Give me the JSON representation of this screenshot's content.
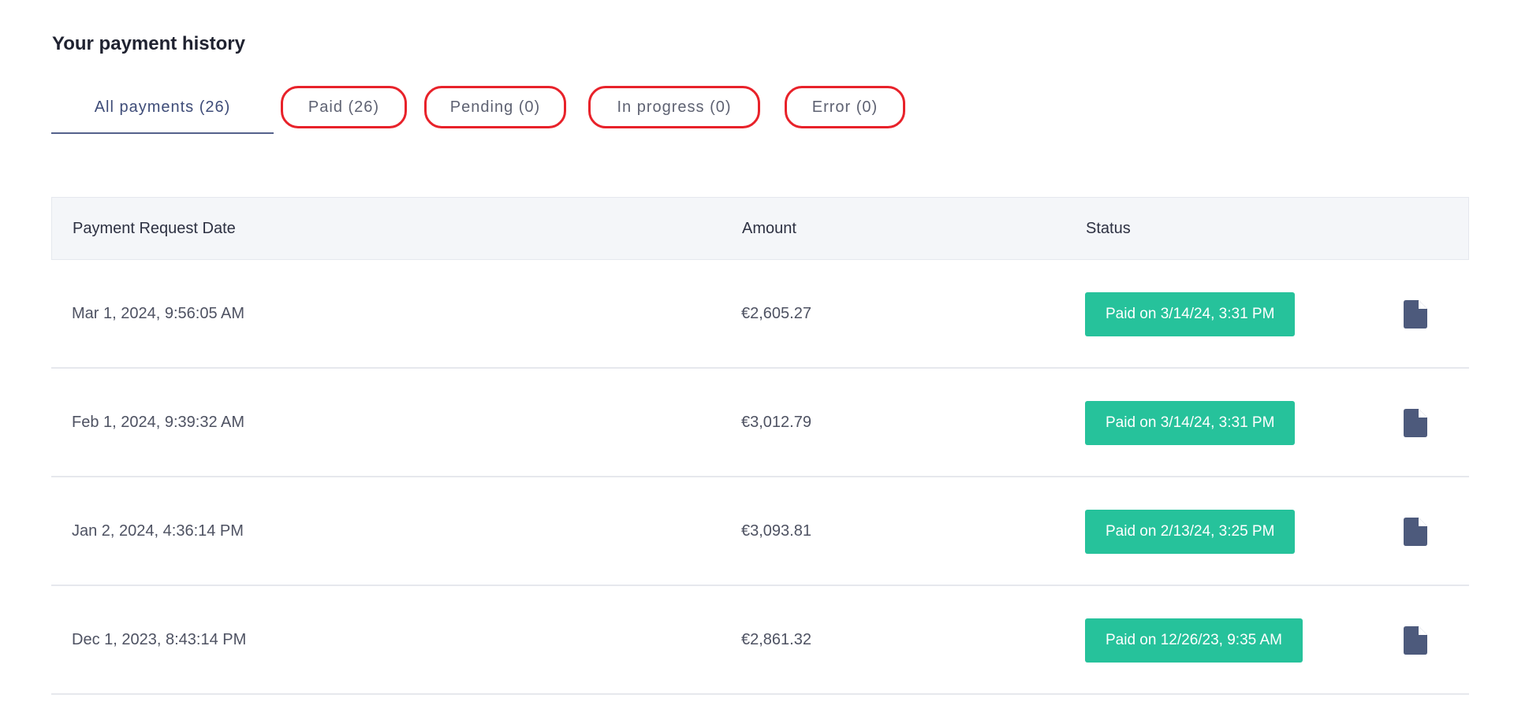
{
  "page_title": "Your payment history",
  "tabs": [
    {
      "label": "All payments (26)",
      "active": true
    },
    {
      "label": "Paid (26)",
      "active": false
    },
    {
      "label": "Pending (0)",
      "active": false
    },
    {
      "label": "In progress (0)",
      "active": false
    },
    {
      "label": "Error (0)",
      "active": false
    }
  ],
  "table": {
    "headers": {
      "date": "Payment Request Date",
      "amount": "Amount",
      "status": "Status"
    },
    "rows": [
      {
        "date": "Mar 1, 2024, 9:56:05 AM",
        "amount": "€2,605.27",
        "status": "Paid on 3/14/24, 3:31 PM",
        "icon": "document-icon"
      },
      {
        "date": "Feb 1, 2024, 9:39:32 AM",
        "amount": "€3,012.79",
        "status": "Paid on 3/14/24, 3:31 PM",
        "icon": "document-icon"
      },
      {
        "date": "Jan 2, 2024, 4:36:14 PM",
        "amount": "€3,093.81",
        "status": "Paid on 2/13/24, 3:25 PM",
        "icon": "document-icon"
      },
      {
        "date": "Dec 1, 2023, 8:43:14 PM",
        "amount": "€2,861.32",
        "status": "Paid on 12/26/23, 9:35 AM",
        "icon": "document-icon"
      }
    ]
  },
  "colors": {
    "status_paid": "#26c29b",
    "active_tab": "#3e4c78",
    "highlight_outline": "#e8222a",
    "icon": "#4d5a7c"
  }
}
